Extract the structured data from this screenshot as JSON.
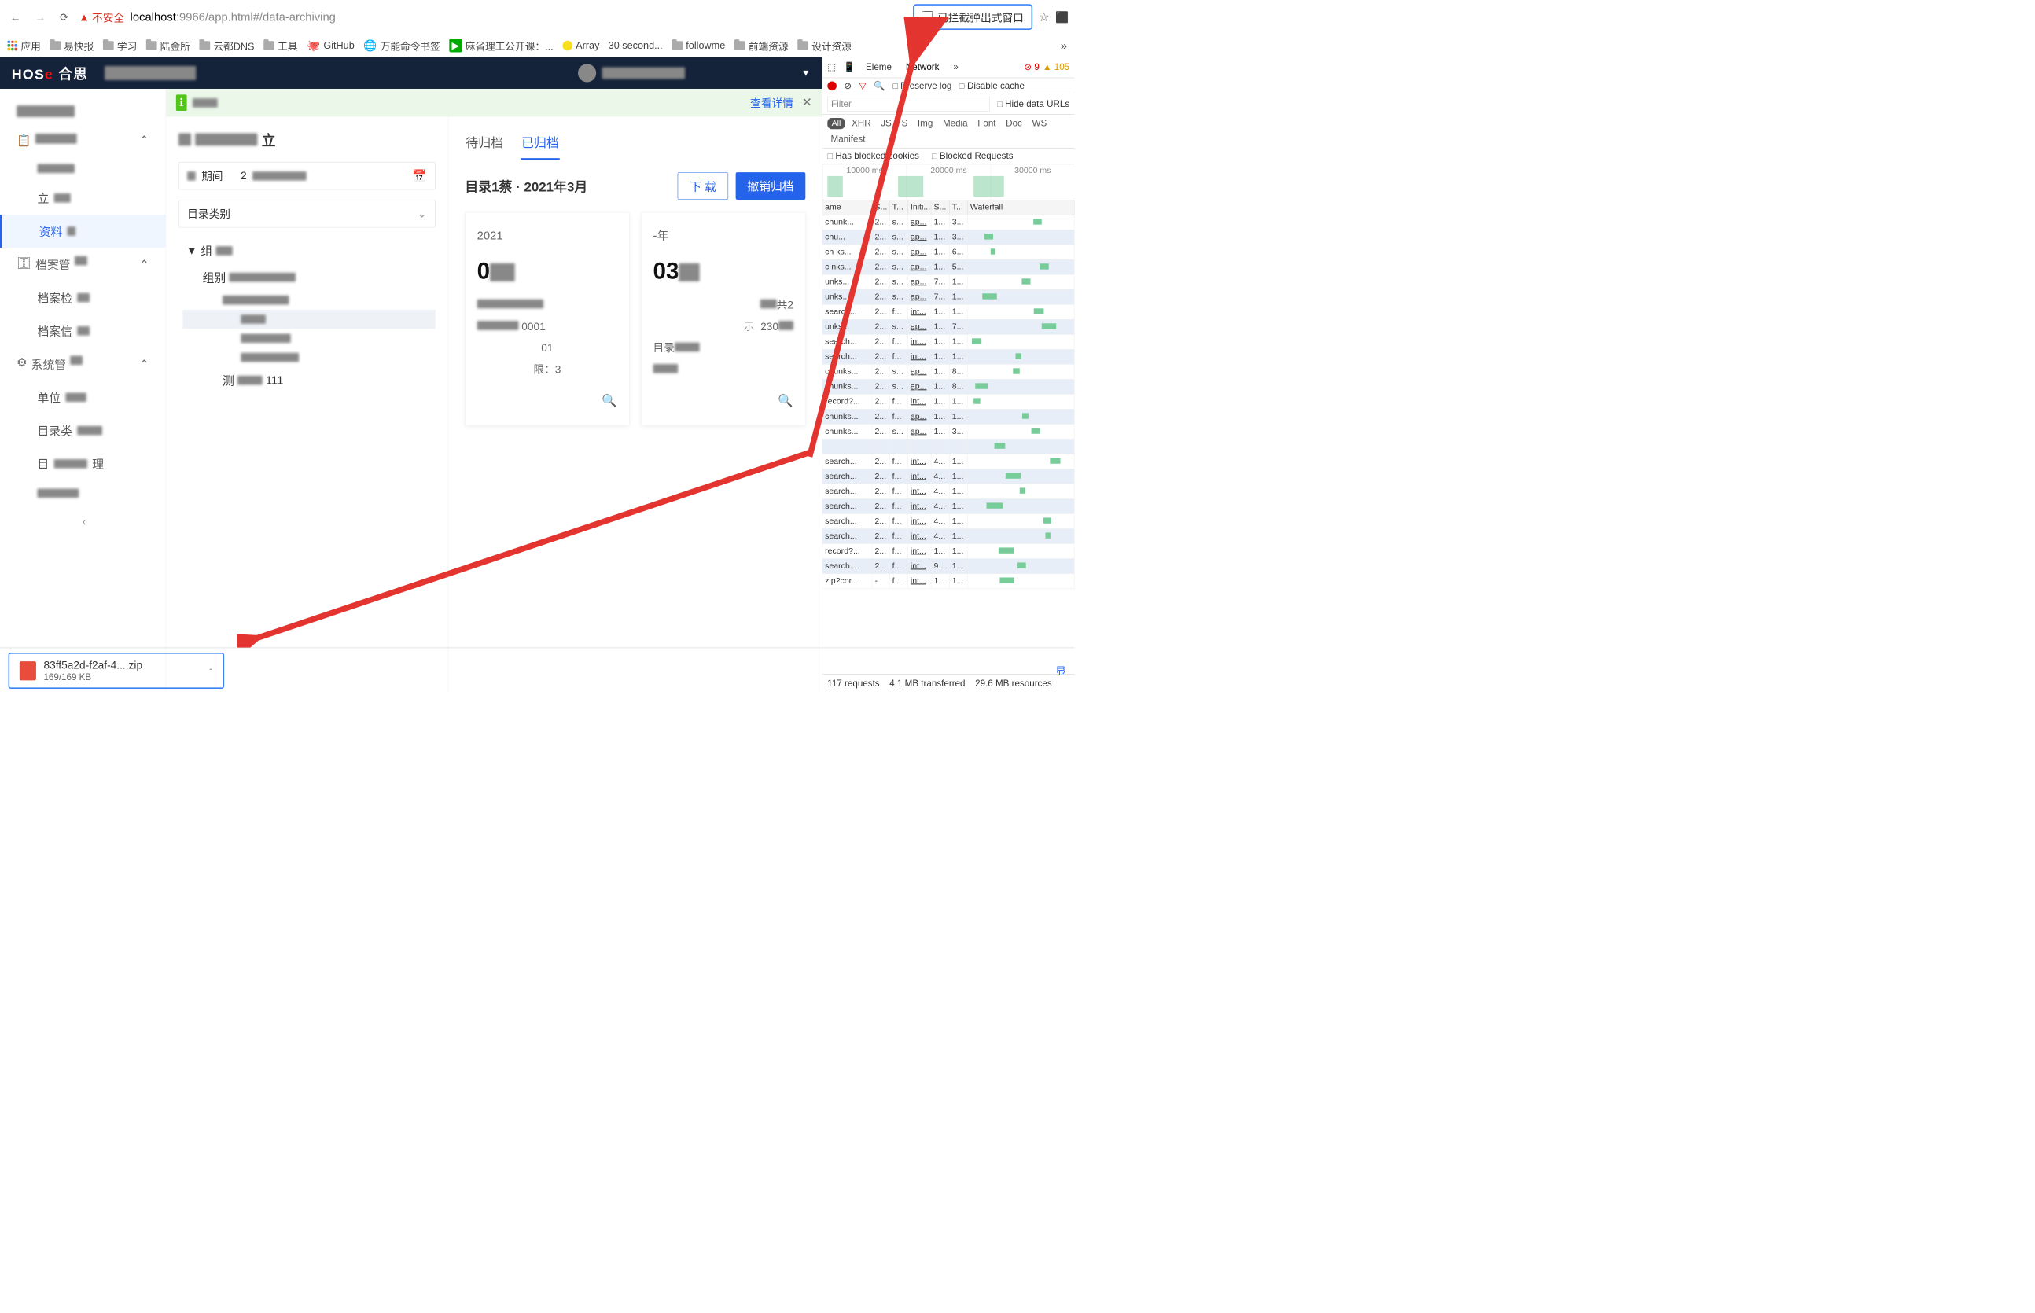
{
  "chrome": {
    "insecure_label": "不安全",
    "url_host": "localhost",
    "url_rest": ":9966/app.html#/data-archiving",
    "popup_blocked": "已拦截弹出式窗口",
    "star": "☆",
    "ext": "⬛",
    "warn_errors": "9",
    "warn_warnings": "105"
  },
  "bookmarks": {
    "apps": "应用",
    "items": [
      "易快报",
      "学习",
      "陆金所",
      "云都DNS",
      "工具",
      "GitHub",
      "万能命令书签",
      "麻省理工公开课：...",
      "Array - 30 second...",
      "followme",
      "前端资源",
      "设计资源"
    ],
    "overflow": "»"
  },
  "app": {
    "logo_main": "HOS",
    "logo_accent": "e",
    "logo_cn": "合思",
    "header_blur": "",
    "notice_link": "查看详情",
    "notice_close": "✕"
  },
  "sidebar": {
    "groups": [
      {
        "label": "",
        "type": "group",
        "icon": "📁"
      },
      {
        "label": "",
        "type": "sub"
      },
      {
        "label": "立",
        "type": "sub"
      },
      {
        "label": "资料",
        "type": "sub",
        "active": true
      },
      {
        "label": "档案管",
        "type": "group",
        "icon": "🗂"
      },
      {
        "label": "档案检",
        "type": "sub"
      },
      {
        "label": "档案信",
        "type": "sub"
      },
      {
        "label": "系统管",
        "type": "group",
        "icon": "⚙"
      },
      {
        "label": "单位",
        "type": "sub"
      },
      {
        "label": "目录类",
        "type": "sub"
      },
      {
        "label": "目",
        "type": "sub",
        "tail": "理"
      },
      {
        "label": "",
        "type": "sub"
      }
    ],
    "collapse": "〈"
  },
  "left": {
    "title_head": "",
    "title_label": "立",
    "period_label": "期间",
    "period_val": "2",
    "cat_label": "目录类别",
    "tree": [
      {
        "txt": "组",
        "lvl": 0,
        "caret": "▼"
      },
      {
        "txt": "组别",
        "lvl": 1
      },
      {
        "txt": "",
        "lvl": 2,
        "sel": true
      },
      {
        "txt": "",
        "lvl": 3
      },
      {
        "txt": "",
        "lvl": 3
      },
      {
        "txt": "",
        "lvl": 3
      },
      {
        "txt": "测",
        "lvl": 2,
        "tail": "111"
      }
    ]
  },
  "right": {
    "tabs": {
      "pending": "待归档",
      "done": "已归档"
    },
    "title": "目录1蔡 · 2021年3月",
    "download": "下 载",
    "revoke": "撤销归档",
    "card1": {
      "year": "2021",
      "big": "0",
      "l1": "",
      "l2": "0001",
      "l3": "01",
      "l4": "限：3"
    },
    "card2": {
      "year": "-年",
      "big": "03",
      "l1": "共2",
      "l2": "230",
      "l3": "",
      "l4": ""
    },
    "view_icon": "🔍"
  },
  "devtools": {
    "tabs": {
      "elements": "Eleme",
      "network": "Network",
      "more": "»"
    },
    "row2": {
      "preserve": "Preserve log",
      "disable": "Disable cache"
    },
    "filter_ph": "Filter",
    "hide_urls": "Hide data URLs",
    "types": [
      "All",
      "XHR",
      "JS",
      "S",
      "Img",
      "Media",
      "Font",
      "Doc",
      "WS",
      "Manifest"
    ],
    "blocked1": "Has blocked",
    "blocked1b": "cookies",
    "blocked2": "Blocked Requests",
    "timeline": [
      "10000 ms",
      "20000 ms",
      "30000 ms"
    ],
    "cols": [
      "ame",
      "S...",
      "T...",
      "Initi...",
      "S...",
      "T...",
      "Waterfall"
    ],
    "rows": [
      [
        "chunk...",
        "2...",
        "s...",
        "ap...",
        "1...",
        "3..."
      ],
      [
        "chu...",
        "2...",
        "s...",
        "ap...",
        "1...",
        "3..."
      ],
      [
        "ch ks...",
        "2...",
        "s...",
        "ap...",
        "1...",
        "6..."
      ],
      [
        "c  nks...",
        "2...",
        "s...",
        "ap...",
        "1...",
        "5..."
      ],
      [
        "  unks...",
        "2...",
        "s...",
        "ap...",
        "7...",
        "1..."
      ],
      [
        "  unks...",
        "2...",
        "s...",
        "ap...",
        "7...",
        "1..."
      ],
      [
        "search...",
        "2...",
        "f...",
        "int...",
        "1...",
        "1..."
      ],
      [
        "  unks...",
        "2...",
        "s...",
        "ap...",
        "1...",
        "7..."
      ],
      [
        "search...",
        "2...",
        "f...",
        "int...",
        "1...",
        "1..."
      ],
      [
        "search...",
        "2...",
        "f...",
        "int...",
        "1...",
        "1..."
      ],
      [
        "chunks...",
        "2...",
        "s...",
        "ap...",
        "1...",
        "8..."
      ],
      [
        "chunks...",
        "2...",
        "s...",
        "ap...",
        "1...",
        "8..."
      ],
      [
        "record?...",
        "2...",
        "f...",
        "int...",
        "1...",
        "1..."
      ],
      [
        "chunks...",
        "2...",
        "f...",
        "ap...",
        "1...",
        "1..."
      ],
      [
        "chunks...",
        "2...",
        "s...",
        "ap...",
        "1...",
        "3..."
      ],
      [
        "",
        "",
        "",
        "",
        "",
        ""
      ],
      [
        "search...",
        "2...",
        "f...",
        "int...",
        "4...",
        "1..."
      ],
      [
        "search...",
        "2...",
        "f...",
        "int...",
        "4...",
        "1..."
      ],
      [
        "search...",
        "2...",
        "f...",
        "int...",
        "4...",
        "1..."
      ],
      [
        "search...",
        "2...",
        "f...",
        "int...",
        "4...",
        "1..."
      ],
      [
        "search...",
        "2...",
        "f...",
        "int...",
        "4...",
        "1..."
      ],
      [
        "search...",
        "2...",
        "f...",
        "int...",
        "4...",
        "1..."
      ],
      [
        "record?...",
        "2...",
        "f...",
        "int...",
        "1...",
        "1..."
      ],
      [
        "search...",
        "2...",
        "f...",
        "int...",
        "9...",
        "1..."
      ],
      [
        "zip?cor...",
        "-",
        "f...",
        "int...",
        "1...",
        "1..."
      ]
    ],
    "status": {
      "reqs": "117 requests",
      "xfer": "4.1 MB transferred",
      "res": "29.6 MB resources"
    }
  },
  "download": {
    "file": "83ff5a2d-f2af-4....zip",
    "size": "169/169 KB",
    "chev": "⌃",
    "show": "显"
  }
}
